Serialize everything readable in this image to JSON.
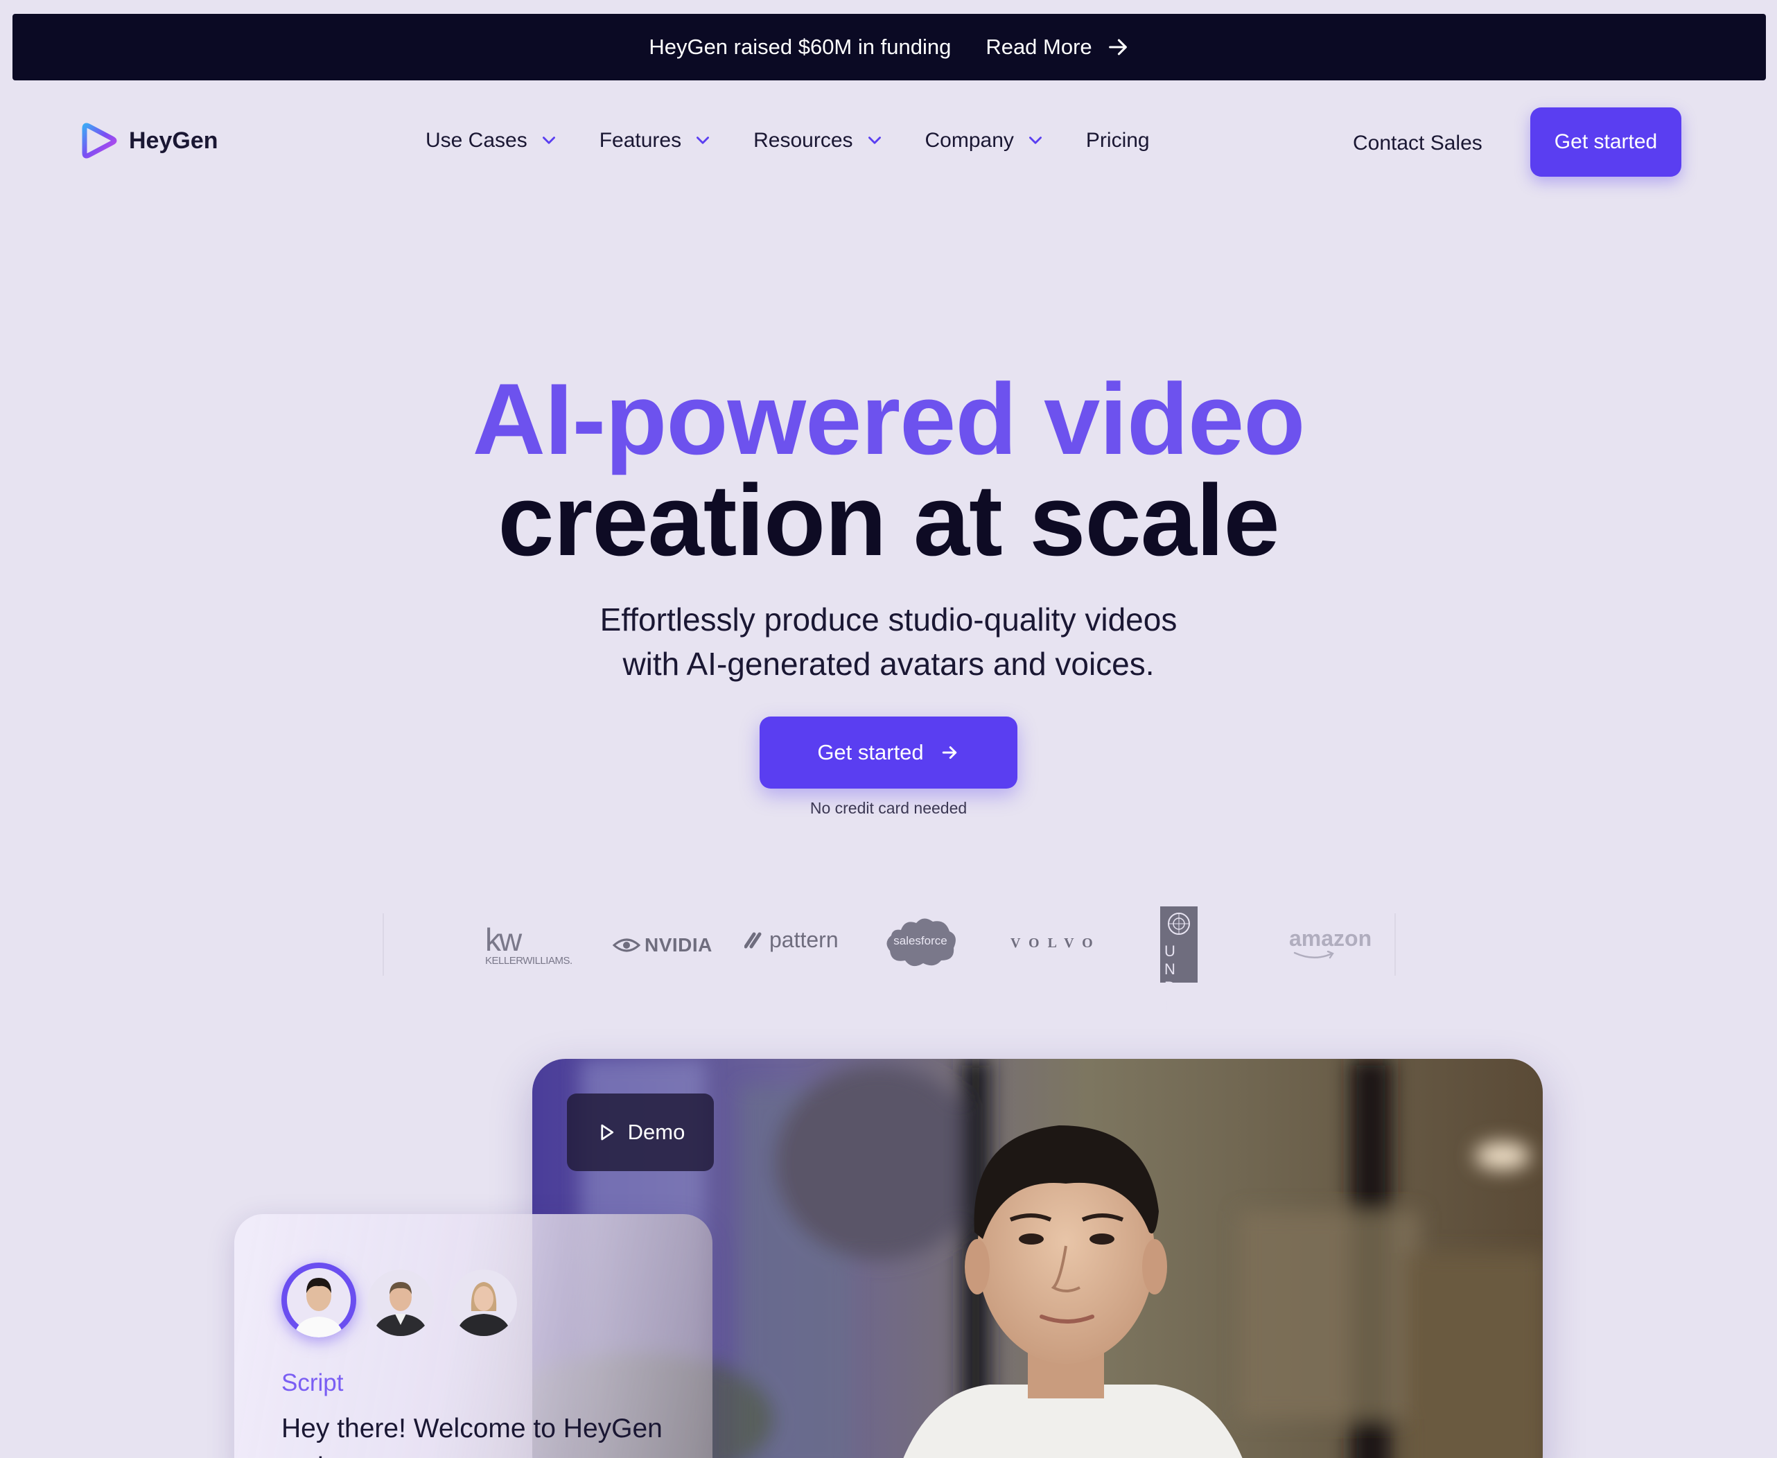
{
  "banner": {
    "text": "HeyGen raised $60M in funding",
    "link_label": "Read More"
  },
  "brand": {
    "name": "HeyGen",
    "accent": "#5a3ef1",
    "heading_accent": "#6d52ee",
    "dark": "#0e0b24"
  },
  "nav": {
    "items": [
      {
        "label": "Use Cases",
        "dropdown": true
      },
      {
        "label": "Features",
        "dropdown": true
      },
      {
        "label": "Resources",
        "dropdown": true
      },
      {
        "label": "Company",
        "dropdown": true
      },
      {
        "label": "Pricing",
        "dropdown": false
      }
    ],
    "contact_label": "Contact Sales",
    "get_started_label": "Get started"
  },
  "hero": {
    "title_line1": "AI-powered video",
    "title_line2": "creation at scale",
    "subtitle_line1": "Effortlessly produce studio-quality videos",
    "subtitle_line2": "with AI-generated avatars and voices.",
    "cta_label": "Get started",
    "cta_note": "No credit card needed"
  },
  "logos": {
    "items": [
      "KELLERWILLIAMS.",
      "NVIDIA",
      "pattern",
      "salesforce",
      "VOLVO",
      "UNDP",
      "amazon"
    ],
    "kw_mark": "kw"
  },
  "demo": {
    "button_label": "Demo",
    "script_label": "Script",
    "script_text": "Hey there! Welcome to HeyGen - where you can"
  }
}
